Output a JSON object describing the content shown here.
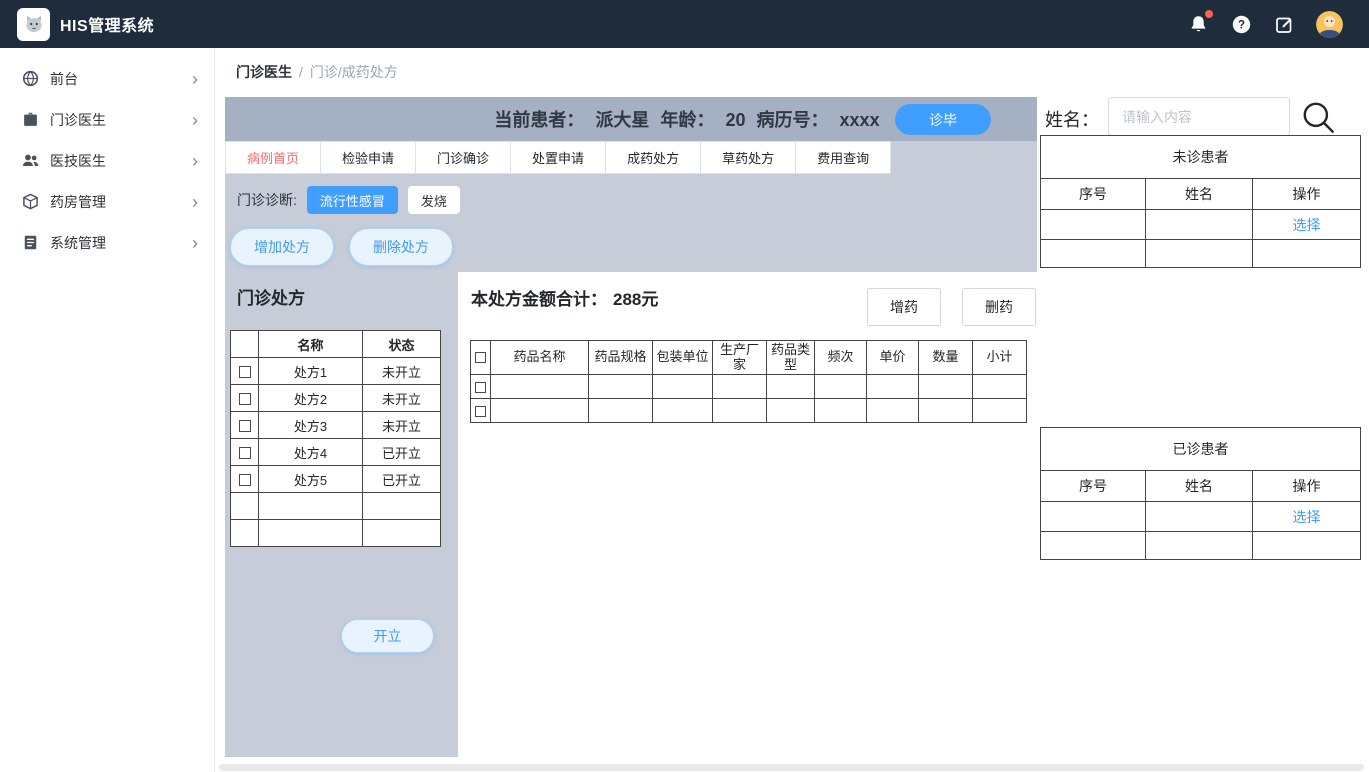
{
  "colors": {
    "accent_blue": "#409eff",
    "active_tab_text": "#f56c6c",
    "topbar_bg": "#1e2c3c",
    "panel_bg": "#c6cdd9",
    "panel_header_bg": "#a5b1c3"
  },
  "topbar": {
    "title": "HIS管理系统",
    "icons": [
      "bell-icon",
      "help-icon",
      "compose-icon",
      "user-avatar"
    ]
  },
  "sidebar": {
    "items": [
      {
        "label": "前台",
        "icon": "globe-icon"
      },
      {
        "label": "门诊医生",
        "icon": "briefcase-icon"
      },
      {
        "label": "医技医生",
        "icon": "users-icon"
      },
      {
        "label": "药房管理",
        "icon": "cube-icon"
      },
      {
        "label": "系统管理",
        "icon": "document-icon"
      }
    ]
  },
  "breadcrumb": {
    "root": "门诊医生",
    "separator": "/",
    "current": "门诊/成药处方"
  },
  "patient_bar": {
    "patient_label": "当前患者：",
    "patient_name": "派大星",
    "age_label": "年龄：",
    "age": "20",
    "record_label": "病历号：",
    "record_no": "xxxx",
    "finish_button": "诊毕"
  },
  "tabs": [
    {
      "label": "病例首页",
      "active": true
    },
    {
      "label": "检验申请",
      "active": false
    },
    {
      "label": "门诊确诊",
      "active": false
    },
    {
      "label": "处置申请",
      "active": false
    },
    {
      "label": "成药处方",
      "active": false
    },
    {
      "label": "草药处方",
      "active": false
    },
    {
      "label": "费用查询",
      "active": false
    }
  ],
  "diagnosis": {
    "label": "门诊诊断:",
    "tags": [
      {
        "label": "流行性感冒",
        "active": true
      },
      {
        "label": "发烧",
        "active": false
      }
    ]
  },
  "rx": {
    "add_button": "增加处方",
    "delete_button": "删除处方",
    "panel_title": "门诊处方",
    "headers": [
      "名称",
      "状态"
    ],
    "rows": [
      {
        "name": "处方1",
        "status": "未开立"
      },
      {
        "name": "处方2",
        "status": "未开立"
      },
      {
        "name": "处方3",
        "status": "未开立"
      },
      {
        "name": "处方4",
        "status": "已开立"
      },
      {
        "name": "处方5",
        "status": "已开立"
      },
      {
        "name": "",
        "status": ""
      },
      {
        "name": "",
        "status": ""
      }
    ],
    "open_button": "开立"
  },
  "medicine": {
    "total_label": "本处方金额合计：",
    "total_value": "288元",
    "add_button": "增药",
    "delete_button": "删药",
    "headers": [
      "药品名称",
      "药品规格",
      "包装单位",
      "生产厂家",
      "药品类型",
      "频次",
      "单价",
      "数量",
      "小计"
    ],
    "empty_row_count": 2
  },
  "patient_search": {
    "label": "姓名：",
    "placeholder": "请输入内容"
  },
  "undiagnosed": {
    "title": "未诊患者",
    "headers": [
      "序号",
      "姓名",
      "操作"
    ],
    "action": "选择"
  },
  "diagnosed": {
    "title": "已诊患者",
    "headers": [
      "序号",
      "姓名",
      "操作"
    ],
    "action": "选择"
  }
}
